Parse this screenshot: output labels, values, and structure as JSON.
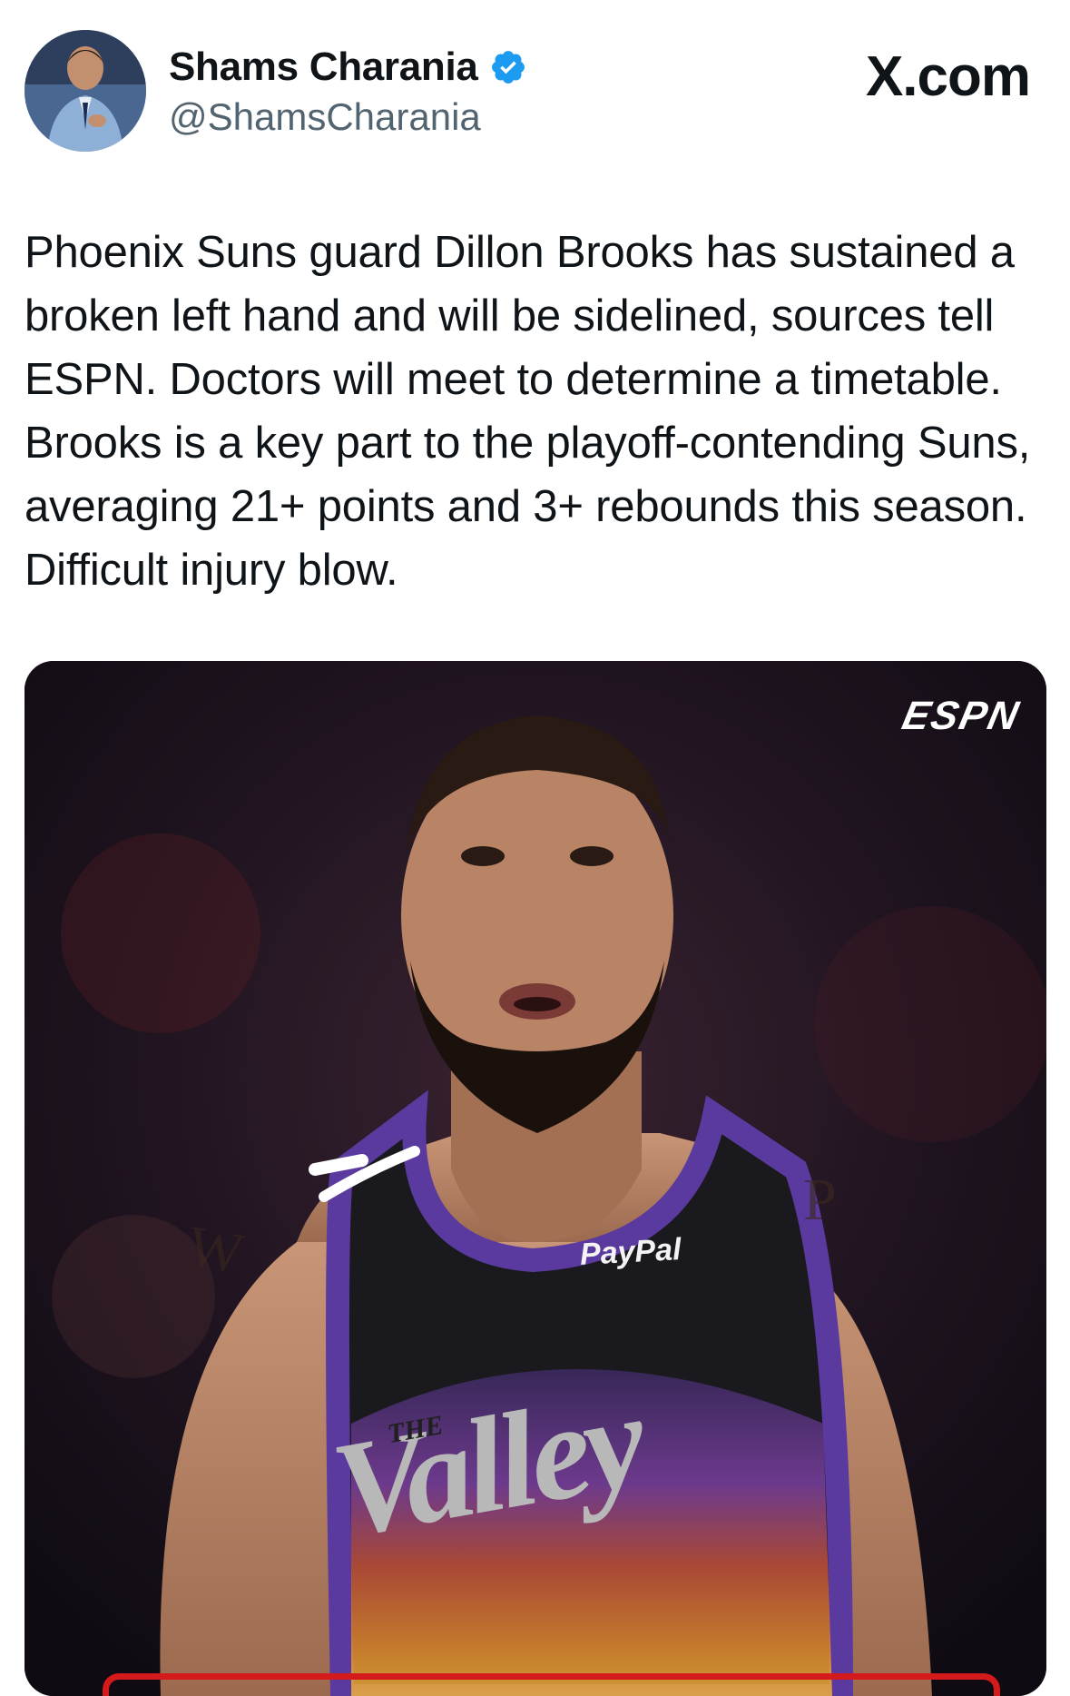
{
  "author": {
    "display_name": "Shams Charania",
    "handle": "@ShamsCharania",
    "verified": true
  },
  "brand": "X.com",
  "tweet": {
    "text": "Phoenix Suns guard Dillon Brooks has sustained a broken left hand and will be sidelined, sources tell ESPN. Doctors will meet to determine a timetable. Brooks is a key part to the playoff-contending Suns, averaging 21+ points and 3+ rebounds this season. Difficult injury blow."
  },
  "media": {
    "logo": "ESPN",
    "jersey_sponsor": "PayPal",
    "jersey_the": "THE",
    "jersey_wordmark": "Valley",
    "tattoo_left": "W",
    "tattoo_right": "P"
  },
  "colors": {
    "text_primary": "#0f1419",
    "text_secondary": "#536471",
    "verified_blue": "#1d9bf0",
    "media_frame_red": "#d41a1a",
    "jersey_purple": "#5b3aa0"
  },
  "icons": {
    "verified": "verified-badge-icon"
  }
}
